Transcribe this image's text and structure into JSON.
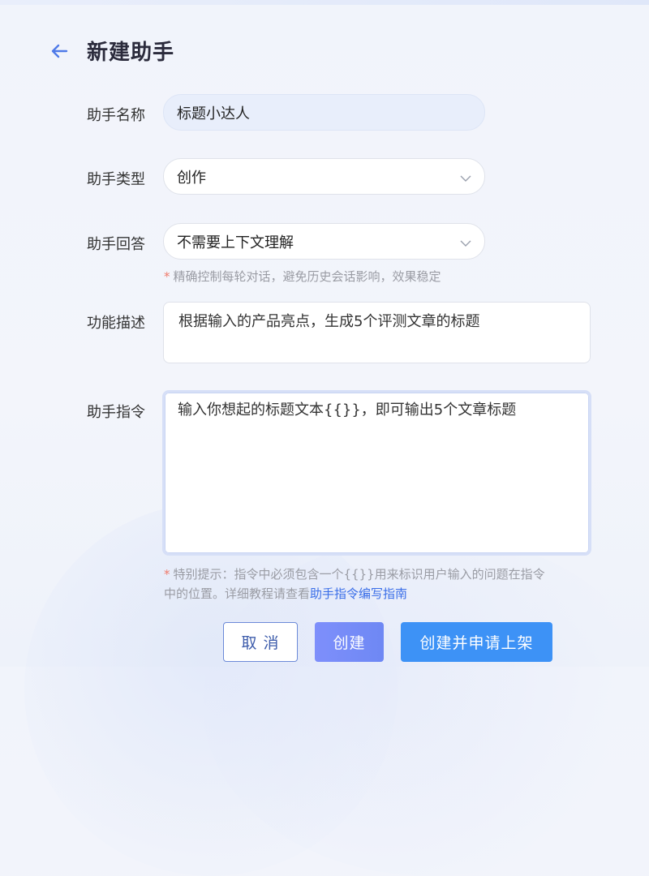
{
  "header": {
    "back_icon": "arrow-left-icon",
    "title": "新建助手"
  },
  "form": {
    "name": {
      "label": "助手名称",
      "value": "标题小达人"
    },
    "type": {
      "label": "助手类型",
      "value": "创作",
      "icon": "chevron-down-icon"
    },
    "answer": {
      "label": "助手回答",
      "value": "不需要上下文理解",
      "icon": "chevron-down-icon",
      "hint_star": "*",
      "hint": "精确控制每轮对话，避免历史会话影响，效果稳定"
    },
    "description": {
      "label": "功能描述",
      "value": "根据输入的产品亮点，生成5个评测文章的标题"
    },
    "instruction": {
      "label": "助手指令",
      "value": "输入你想起的标题文本{{}}，即可输出5个文章标题",
      "hint_star": "*",
      "hint_line1": "特别提示：指令中必须包含一个{{}}用来标识用户输入的问题在指令",
      "hint_line2": "中的位置。详细教程请查看",
      "hint_link": "助手指令编写指南"
    }
  },
  "buttons": {
    "cancel": "取 消",
    "create": "创建",
    "create_publish": "创建并申请上架"
  },
  "colors": {
    "accent": "#3d92f6",
    "primary_gradient_start": "#7e8ffb",
    "link": "#3a6ee8",
    "hint_star": "#f07a6a"
  }
}
